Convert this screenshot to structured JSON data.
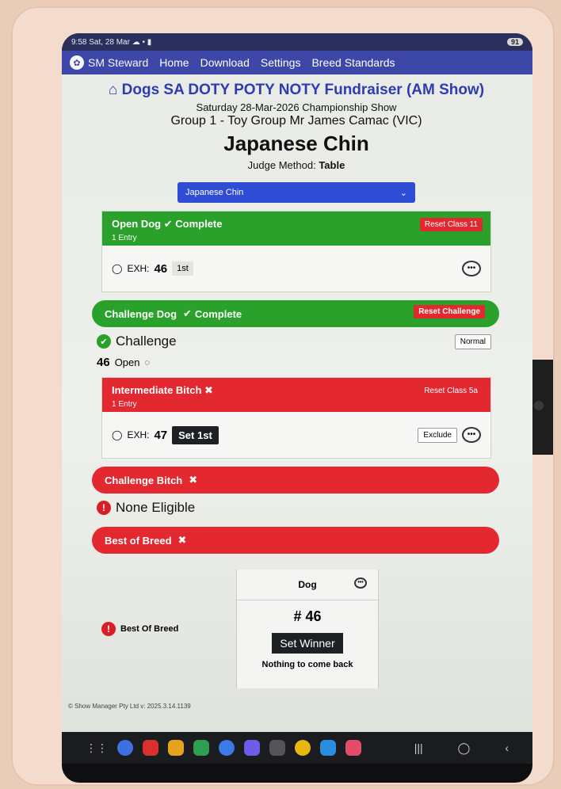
{
  "status": {
    "time": "9:58",
    "date": "Sat, 28 Mar",
    "battery": "91"
  },
  "nav": {
    "brand": "SM Steward",
    "items": [
      "Home",
      "Download",
      "Settings",
      "Breed Standards"
    ]
  },
  "page": {
    "title": "Dogs SA DOTY POTY NOTY Fundraiser (AM Show)",
    "subtitle": "Saturday 28-Mar-2026 Championship Show",
    "group": "Group 1 - Toy Group Mr James Camac (VIC)",
    "breed": "Japanese Chin",
    "judge_method_label": "Judge Method:",
    "judge_method_value": "Table",
    "select_value": "Japanese Chin"
  },
  "open_dog": {
    "title": "Open Dog",
    "status": "Complete",
    "entries": "1 Entry",
    "reset_label": "Reset Class 11",
    "exh_label": "EXH:",
    "exh_num": "46",
    "placing": "1st"
  },
  "challenge_dog": {
    "title": "Challenge Dog",
    "status": "Complete",
    "reset_label": "Reset Challenge",
    "award": "Challenge",
    "normal_label": "Normal",
    "winner_num": "46",
    "winner_class": "Open"
  },
  "intermediate_bitch": {
    "title": "Intermediate Bitch",
    "entries": "1 Entry",
    "reset_label": "Reset Class 5a",
    "exh_label": "EXH:",
    "exh_num": "47",
    "set_label": "Set 1st",
    "exclude_label": "Exclude"
  },
  "challenge_bitch": {
    "title": "Challenge Bitch",
    "none_eligible": "None Eligible"
  },
  "best_of_breed": {
    "title": "Best of Breed",
    "label": "Best Of Breed",
    "col_header": "Dog",
    "num": "# 46",
    "set_winner": "Set Winner",
    "nothing": "Nothing to come back"
  },
  "footer": {
    "text": "© Show Manager Pty Ltd v: 2025.3.14.1139"
  }
}
